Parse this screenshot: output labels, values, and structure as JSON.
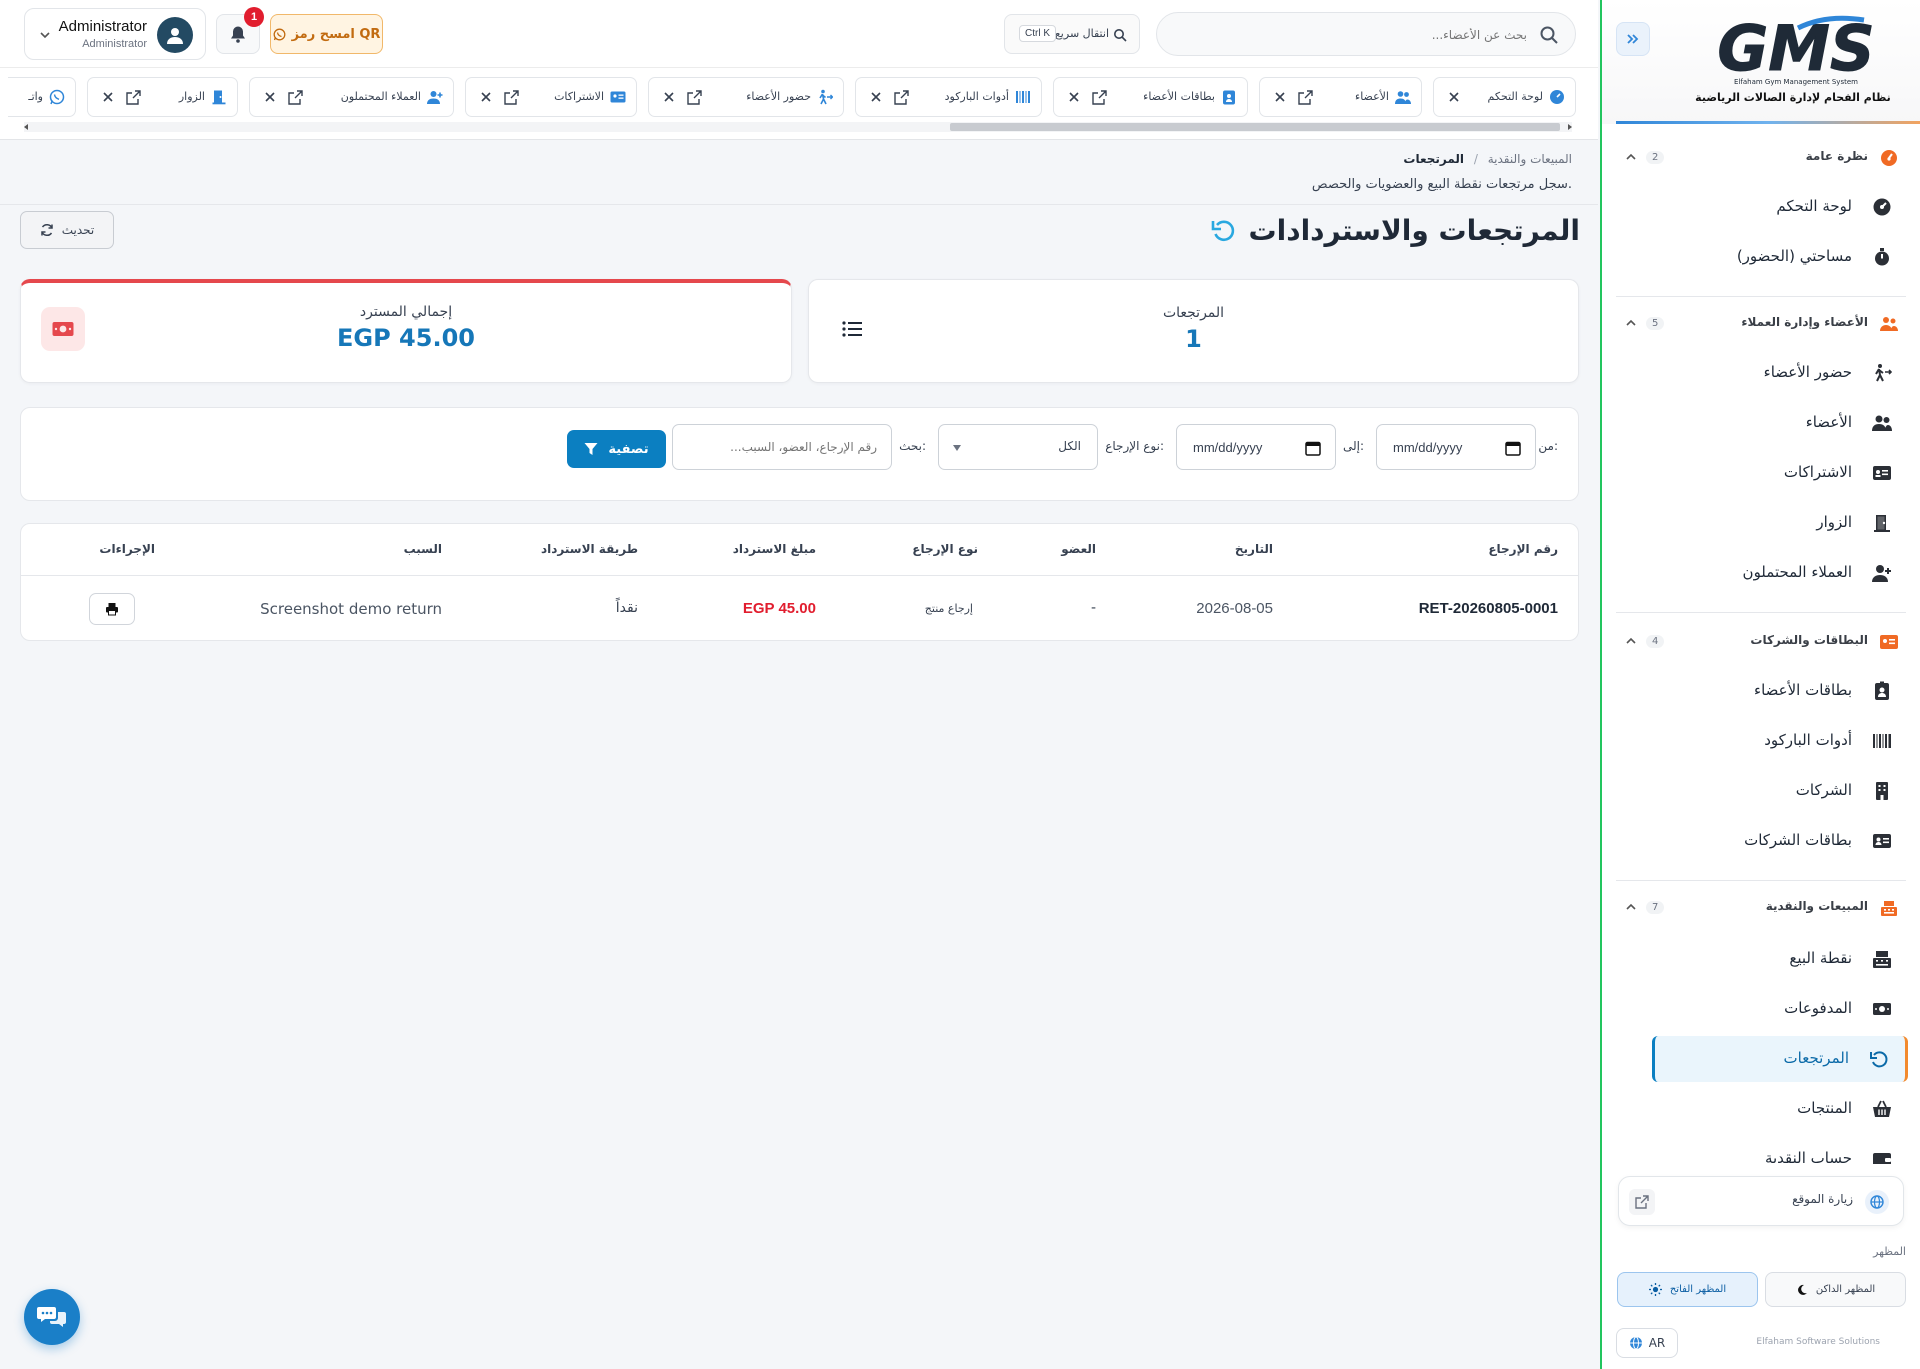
{
  "colors": {
    "primary": "#0b7fc1",
    "sidebar_border": "#22c55e",
    "danger": "#e5484d",
    "accent_orange": "#f28a2e"
  },
  "sidebar": {
    "logo_text": "GMS",
    "logo_subtext": "Elfaham Gym Management System",
    "logo_caption": "نظام الفحام لإدارة الصالات الرياضية",
    "sections": [
      {
        "title": "نظرة عامة",
        "count": "2",
        "icon": "gauge-icon"
      },
      {
        "title": "الأعضاء وإدارة العملاء",
        "count": "5",
        "icon": "users-icon"
      },
      {
        "title": "البطاقات والشركات",
        "count": "4",
        "icon": "id-card-icon"
      },
      {
        "title": "المبيعات والنقدية",
        "count": "7",
        "icon": "cash-register-icon"
      }
    ],
    "items": [
      {
        "label": "لوحة التحكم",
        "icon": "dashboard-icon"
      },
      {
        "label": "مساحتي (الحضور)",
        "icon": "stopwatch-icon"
      },
      {
        "label": "حضور الأعضاء",
        "icon": "walking-icon"
      },
      {
        "label": "الأعضاء",
        "icon": "users-icon"
      },
      {
        "label": "الاشتراكات",
        "icon": "id-card-icon"
      },
      {
        "label": "الزوار",
        "icon": "door-icon"
      },
      {
        "label": "العملاء المحتملون",
        "icon": "user-plus-icon"
      },
      {
        "label": "بطاقات الأعضاء",
        "icon": "id-badge-icon"
      },
      {
        "label": "أدوات الباركود",
        "icon": "barcode-icon"
      },
      {
        "label": "الشركات",
        "icon": "building-icon"
      },
      {
        "label": "بطاقات الشركات",
        "icon": "address-card-icon"
      },
      {
        "label": "نقطة البيع",
        "icon": "cash-register-icon"
      },
      {
        "label": "المدفوعات",
        "icon": "money-icon"
      },
      {
        "label": "المرتجعات",
        "icon": "undo-icon"
      },
      {
        "label": "المنتجات",
        "icon": "basket-icon"
      },
      {
        "label": "حساب النقدية",
        "icon": "wallet-icon"
      }
    ],
    "visit_site": "زيارة الموقع",
    "appearance_label": "المظهر",
    "dark_theme": "المظهر الداكن",
    "light_theme": "المظهر الفاتح",
    "lang": "AR",
    "footer": "Elfaham Software Solutions"
  },
  "topbar": {
    "search_placeholder": "بحث عن الأعضاء...",
    "quick_nav": "انتقال سريع",
    "quick_nav_kbd": "Ctrl K",
    "qr_label": "امسح رمز QR",
    "notif_count": "1",
    "user_name": "Administrator",
    "user_role": "Administrator"
  },
  "tabs": [
    {
      "label": "لوحة التحكم",
      "icon": "dashboard-icon"
    },
    {
      "label": "الأعضاء",
      "icon": "users-icon"
    },
    {
      "label": "بطاقات الأعضاء",
      "icon": "id-badge-icon"
    },
    {
      "label": "أدوات الباركود",
      "icon": "barcode-icon"
    },
    {
      "label": "حضور الأعضاء",
      "icon": "walking-icon"
    },
    {
      "label": "الاشتراكات",
      "icon": "id-card-icon"
    },
    {
      "label": "العملاء المحتملون",
      "icon": "user-plus-icon"
    },
    {
      "label": "الزوار",
      "icon": "door-icon"
    },
    {
      "label": "واتـ",
      "icon": "whatsapp-icon"
    }
  ],
  "page": {
    "breadcrumb_parent": "المبيعات والنقدية",
    "breadcrumb_sep": "/",
    "breadcrumb_current": "المرتجعات",
    "subtitle": "سجل مرتجعات نقطة البيع والعضويات والحصص.",
    "title": "المرتجعات والاستردادات",
    "refresh": "تحديث"
  },
  "stats": {
    "returns_label": "المرتجعات",
    "returns_value": "1",
    "refund_label": "إجمالي المسترد",
    "refund_value": "EGP 45.00"
  },
  "filters": {
    "from_label": "من:",
    "to_label": "إلى:",
    "date_placeholder": "mm/dd/yyyy",
    "type_label": "نوع الإرجاع:",
    "type_value": "الكل",
    "search_label": "بحث:",
    "search_placeholder": "رقم الإرجاع، العضو، السبب...",
    "filter_btn": "تصفية"
  },
  "table": {
    "headers": [
      "رقم الإرجاع",
      "التاريخ",
      "العضو",
      "نوع الإرجاع",
      "مبلغ الاسترداد",
      "طريقة الاسترداد",
      "السبب",
      "الإجراءات"
    ],
    "rows": [
      {
        "id": "RET-20260805-0001",
        "date": "2026-08-05",
        "member": "-",
        "type": "إرجاع منتج",
        "amount": "EGP 45.00",
        "method": "نقداً",
        "reason": "Screenshot demo return"
      }
    ]
  }
}
